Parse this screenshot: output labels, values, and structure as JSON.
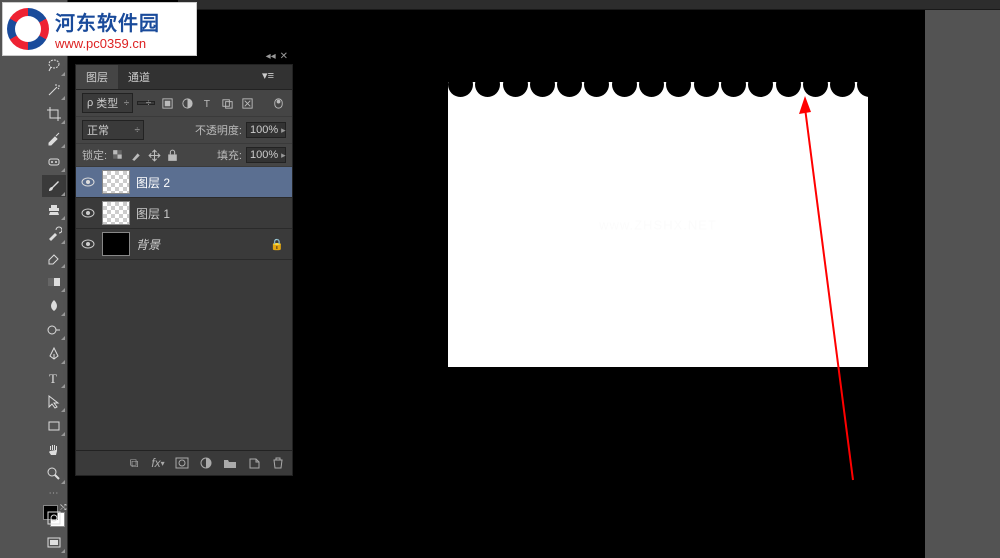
{
  "watermark": {
    "title": "河东软件园",
    "url": "www.pc0359.cn"
  },
  "layers_panel": {
    "tabs": {
      "layers": "图层",
      "channels": "通道"
    },
    "kind_label": "类型",
    "blend_mode": "正常",
    "opacity_label": "不透明度:",
    "opacity_value": "100%",
    "lock_label": "锁定:",
    "fill_label": "填充:",
    "fill_value": "100%",
    "layers": [
      {
        "name": "图层 2",
        "selected": true,
        "thumb": "checker"
      },
      {
        "name": "图层 1",
        "selected": false,
        "thumb": "checker"
      },
      {
        "name": "背景",
        "selected": false,
        "thumb": "black",
        "locked": true
      }
    ]
  },
  "canvas_watermark": "www.ZHSHX.NET"
}
